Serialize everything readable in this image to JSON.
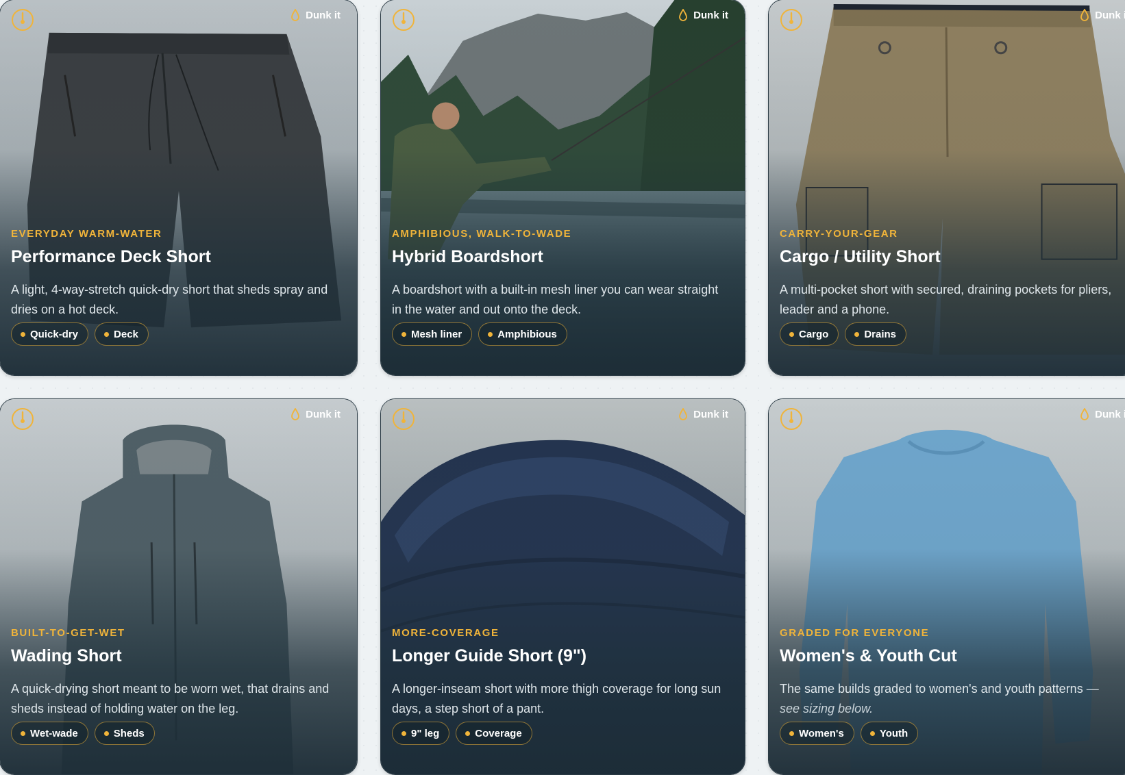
{
  "colors": {
    "accent": "#f0b43a",
    "card_dark": "#1c2c36",
    "page_bg": "#eef2f4"
  },
  "icons": {
    "gauge": "thermometer-gauge-icon",
    "drop": "water-drop-icon",
    "tag_dot": "bullet-dot-icon"
  },
  "cards": [
    {
      "eyebrow": "EVERYDAY WARM-WATER",
      "title": "Performance Deck Short",
      "desc": "A light, 4-way-stretch quick-dry short that sheds spray and dries on a hot deck.",
      "dunk_label": "Dunk it",
      "tags": [
        "Quick-dry",
        "Deck"
      ],
      "photo": "charcoal board short"
    },
    {
      "eyebrow": "AMPHIBIOUS, WALK-TO-WADE",
      "title": "Hybrid Boardshort",
      "desc": "A boardshort with a built-in mesh liner you can wear straight in the water and out onto the deck.",
      "dunk_label": "Dunk it",
      "tags": [
        "Mesh liner",
        "Amphibious"
      ],
      "photo": "angler casting in a mountain river"
    },
    {
      "eyebrow": "CARRY-YOUR-GEAR",
      "title": "Cargo / Utility Short",
      "desc": "A multi-pocket short with secured, draining pockets for pliers, leader and a phone.",
      "dunk_label": "Dunk it",
      "tags": [
        "Cargo",
        "Drains"
      ],
      "photo": "khaki cargo short"
    },
    {
      "eyebrow": "BUILT-TO-GET-WET",
      "title": "Wading Short",
      "desc": "A quick-drying short meant to be worn wet, that drains and sheds instead of holding water on the leg.",
      "dunk_label": "Dunk it",
      "tags": [
        "Wet-wade",
        "Sheds"
      ],
      "photo": "slate rain jacket"
    },
    {
      "eyebrow": "MORE-COVERAGE",
      "title": "Longer Guide Short (9\")",
      "desc": "A longer-inseam short with more thigh coverage for long sun days, a step short of a pant.",
      "dunk_label": "Dunk it",
      "tags": [
        "9\" leg",
        "Coverage"
      ],
      "photo": "navy knit waistband close-up"
    },
    {
      "eyebrow": "GRADED FOR EVERYONE",
      "title": "Women's & Youth Cut",
      "desc": "The same builds graded to women's and youth patterns",
      "desc_note": "— see sizing below.",
      "dunk_label": "Dunk it",
      "tags": [
        "Women's",
        "Youth"
      ],
      "photo": "light blue long-sleeve sun shirt"
    }
  ]
}
